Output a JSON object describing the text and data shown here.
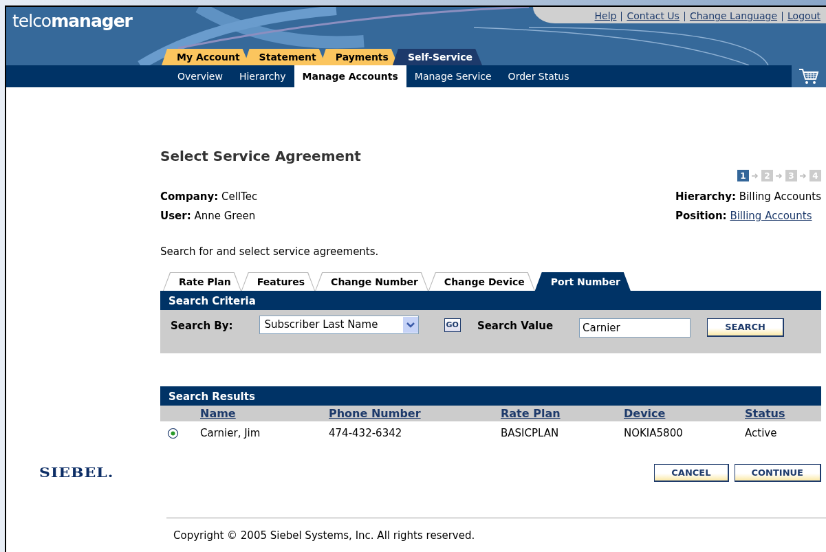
{
  "header": {
    "logo": "telco**manager**",
    "top_links": [
      "Help",
      "Contact Us",
      "Change Language",
      "Logout"
    ],
    "tabs": [
      {
        "label": "My Account",
        "selected": false
      },
      {
        "label": "Statement",
        "selected": false
      },
      {
        "label": "Payments",
        "selected": false
      },
      {
        "label": "Self-Service",
        "selected": true
      }
    ],
    "subnav": [
      {
        "label": "Overview",
        "selected": false
      },
      {
        "label": "Hierarchy",
        "selected": false
      },
      {
        "label": "Manage Accounts",
        "selected": true
      },
      {
        "label": "Manage Service",
        "selected": false
      },
      {
        "label": "Order Status",
        "selected": false
      }
    ]
  },
  "page": {
    "title": "Select Service Agreement",
    "steps": [
      {
        "label": "1",
        "selected": true
      },
      {
        "label": "2",
        "selected": false
      },
      {
        "label": "3",
        "selected": false
      },
      {
        "label": "4",
        "selected": false
      }
    ],
    "left_info": [
      {
        "label": "Company:",
        "value": "CellTec",
        "kind": "text"
      },
      {
        "label": "User:",
        "value": "Anne Green",
        "kind": "text"
      }
    ],
    "right_info": [
      {
        "label": "Hierarchy:",
        "value": "Billing Accounts",
        "kind": "text"
      },
      {
        "label": "Position:",
        "value": "Billing Accounts",
        "kind": "link"
      }
    ],
    "instruction": "Search for and select service agreements."
  },
  "subtabs": [
    {
      "label": "Rate Plan",
      "selected": false
    },
    {
      "label": "Features",
      "selected": false
    },
    {
      "label": "Change Number",
      "selected": false
    },
    {
      "label": "Change Device",
      "selected": false
    },
    {
      "label": "Port Number",
      "selected": true
    }
  ],
  "search_criteria": {
    "title": "Search Criteria",
    "search_by_label": "Search By:",
    "search_by_value": "Subscriber Last Name",
    "go_button": "GO",
    "search_value_label": "Search Value",
    "search_value": "Carnier",
    "search_button": "SEARCH"
  },
  "results": {
    "title": "Search Results",
    "columns": [
      "Name",
      "Phone Number",
      "Rate Plan",
      "Device",
      "Status"
    ],
    "rows": [
      {
        "selected": true,
        "cells": [
          "Carnier, Jim",
          "474-432-6342",
          "BASICPLAN",
          "NOKIA5800",
          "Active"
        ]
      }
    ]
  },
  "brand": "SIEBEL.",
  "buttons": [
    "CANCEL",
    "CONTINUE"
  ],
  "footer": "Copyright © 2005 Siebel Systems, Inc. All rights reserved."
}
